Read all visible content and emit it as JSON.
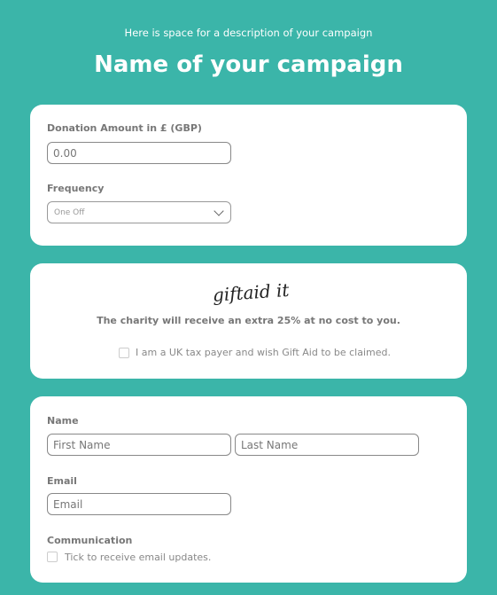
{
  "header": {
    "description": "Here is space for a description of your campaign",
    "title": "Name of your campaign"
  },
  "donation": {
    "amount_label": "Donation Amount in £ (GBP)",
    "amount_placeholder": "0.00",
    "frequency_label": "Frequency",
    "frequency_selected": "One Off"
  },
  "giftaid": {
    "logo_text": "giftaid it",
    "info": "The charity will receive an extra 25% at no cost to you.",
    "checkbox_label": "I am a UK tax payer and wish Gift Aid to be claimed."
  },
  "details": {
    "name_label": "Name",
    "first_name_placeholder": "First Name",
    "last_name_placeholder": "Last Name",
    "email_label": "Email",
    "email_placeholder": "Email",
    "communication_label": "Communication",
    "communication_checkbox_label": "Tick to receive email updates."
  },
  "colors": {
    "background": "#3bb5a9",
    "card": "#ffffff"
  }
}
